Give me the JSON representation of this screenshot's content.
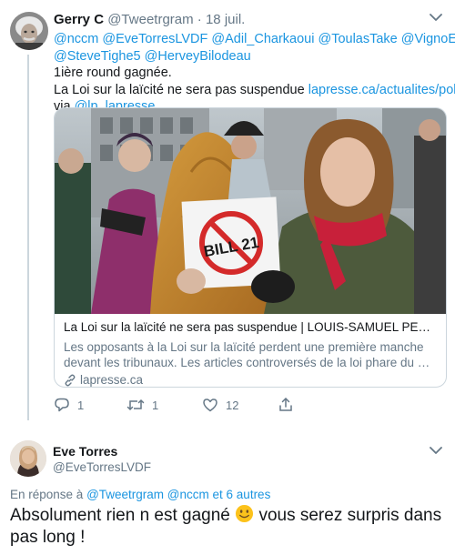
{
  "tweet": {
    "author_name": "Gerry C",
    "author_handle": "@Tweetrgram",
    "separator": "·",
    "date": "18 juil.",
    "mentions_line1": "@nccm @EveTorresLVDF @Adil_Charkaoui @ToulasTake @VignoEva",
    "mentions_line2": "@SteveTighe5 @HerveyBilodeau",
    "text_line1": "1ière round gagnée.",
    "text_line2_prefix": "La Loi sur la laïcité ne sera pas suspendue ",
    "text_line2_link": "lapresse.ca/actualites/pol…",
    "text_line3_prefix": "via ",
    "text_line3_link": "@lp_lapresse",
    "card": {
      "title": "La Loi sur la laïcité ne sera pas suspendue | LOUIS-SAMUEL PERRO…",
      "description_line1": "Les opposants à la Loi sur la laïcité perdent une première manche",
      "description_line2": "devant les tribunaux. Les articles controversés de la loi phare du …",
      "domain": "lapresse.ca",
      "sign_text": "BILL 21"
    },
    "actions": {
      "reply_count": "1",
      "retweet_count": "1",
      "like_count": "12"
    }
  },
  "reply": {
    "author_name": "Eve Torres",
    "author_handle": "@EveTorresLVDF",
    "reply_prefix": "En réponse à",
    "reply_handles": "@Tweetrgram @nccm",
    "reply_suffix": "et 6 autres",
    "text_before_emoji": "Absolument rien n est gagné",
    "text_after_emoji": "vous serez surpris dans pas long !"
  },
  "colors": {
    "link": "#1b95e0",
    "secondary_text": "#657786",
    "border": "#ccd6dd"
  },
  "icons": [
    "chevron-down-icon",
    "reply-icon",
    "retweet-icon",
    "like-icon",
    "share-icon",
    "link-icon",
    "smiley-emoji-icon"
  ]
}
